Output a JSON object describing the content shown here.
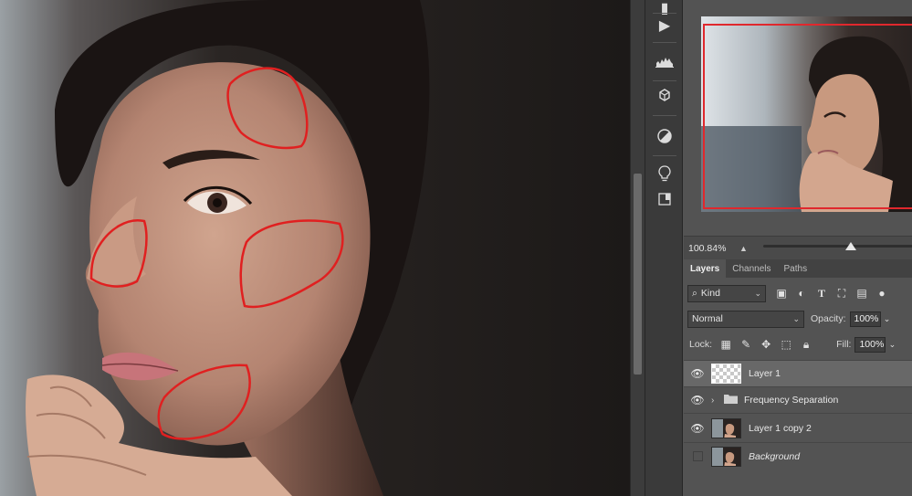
{
  "navigator": {
    "zoom": "100.84%"
  },
  "tabs": [
    {
      "label": "Layers",
      "active": true
    },
    {
      "label": "Channels",
      "active": false
    },
    {
      "label": "Paths",
      "active": false
    }
  ],
  "filter": {
    "kind_label": "Kind"
  },
  "blend": {
    "mode": "Normal",
    "opacity_label": "Opacity:",
    "opacity_value": "100%"
  },
  "lock": {
    "label": "Lock:",
    "fill_label": "Fill:",
    "fill_value": "100%"
  },
  "layers": [
    {
      "name": "Layer 1",
      "visible": true,
      "selected": true
    },
    {
      "name": "Frequency Separation",
      "visible": true,
      "group": true
    },
    {
      "name": "Layer 1 copy 2",
      "visible": true
    },
    {
      "name": "Background",
      "visible": false,
      "italic": true
    }
  ],
  "colors": {
    "annotation": "#e02020",
    "panel_bg": "#535353",
    "selected_layer": "#686868"
  },
  "icons": [
    "play-icon",
    "histogram-icon",
    "3d-cube-icon",
    "adjustment-circle-icon",
    "lightbulb-icon",
    "panel-icon",
    "eye-icon",
    "folder-icon",
    "lock-icon"
  ]
}
